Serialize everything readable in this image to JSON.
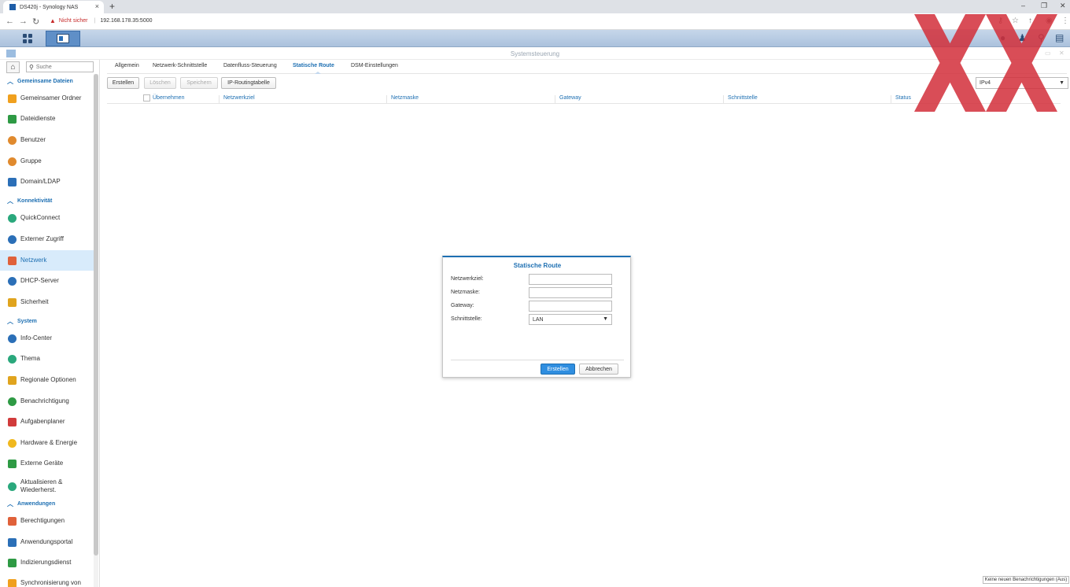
{
  "browser": {
    "tab_title": "DS420j - Synology NAS",
    "new_tab": "+",
    "not_secure": "Nicht sicher",
    "url": "192.168.178.35:5000"
  },
  "window": {
    "title": "Systemsteuerung"
  },
  "sidebar": {
    "search_placeholder": "Suche",
    "sections": [
      {
        "label": "Gemeinsame Dateien"
      },
      {
        "label": "Konnektivität"
      },
      {
        "label": "System"
      },
      {
        "label": "Anwendungen"
      }
    ],
    "items": [
      {
        "label": "Gemeinsamer Ordner",
        "color": "#f0a01e"
      },
      {
        "label": "Dateidienste",
        "color": "#2e9a44"
      },
      {
        "label": "Benutzer",
        "color": "#e08a2e"
      },
      {
        "label": "Gruppe",
        "color": "#e08a2e"
      },
      {
        "label": "Domain/LDAP",
        "color": "#2b6fb7"
      },
      {
        "label": "QuickConnect",
        "color": "#2aa87c"
      },
      {
        "label": "Externer Zugriff",
        "color": "#2b6fb7"
      },
      {
        "label": "Netzwerk",
        "color": "#e0613a"
      },
      {
        "label": "DHCP-Server",
        "color": "#2b6fb7"
      },
      {
        "label": "Sicherheit",
        "color": "#e0a41e"
      },
      {
        "label": "Info-Center",
        "color": "#2b6fb7"
      },
      {
        "label": "Thema",
        "color": "#2aa87c"
      },
      {
        "label": "Regionale Optionen",
        "color": "#e0a41e"
      },
      {
        "label": "Benachrichtigung",
        "color": "#2e9a44"
      },
      {
        "label": "Aufgabenplaner",
        "color": "#d13b3b"
      },
      {
        "label": "Hardware & Energie",
        "color": "#f0b81e"
      },
      {
        "label": "Externe Geräte",
        "color": "#2e9a44"
      },
      {
        "label": "Aktualisieren & Wiederherst.",
        "color": "#2aa87c"
      },
      {
        "label": "Berechtigungen",
        "color": "#e0613a"
      },
      {
        "label": "Anwendungsportal",
        "color": "#2b6fb7"
      },
      {
        "label": "Indizierungsdienst",
        "color": "#2e9a44"
      },
      {
        "label": "Synchronisierung von",
        "color": "#f0a01e"
      }
    ]
  },
  "tabs": [
    "Allgemein",
    "Netzwerk-Schnittstelle",
    "Datenfluss-Steuerung",
    "Statische Route",
    "DSM-Einstellungen"
  ],
  "toolbar": {
    "create": "Erstellen",
    "delete": "Löschen",
    "save": "Speichern",
    "routing_table": "IP-Routingtabelle",
    "ip_version": "IPv4"
  },
  "table": {
    "columns": [
      "Übernehmen",
      "Netzwerkziel",
      "Netzmaske",
      "Gateway",
      "Schnittstelle",
      "Status"
    ]
  },
  "dialog": {
    "title": "Statische Route",
    "fields": {
      "network_target": "Netzwerkziel:",
      "netmask": "Netzmaske:",
      "gateway": "Gateway:",
      "interface": "Schnittstelle:"
    },
    "interface_value": "LAN",
    "create": "Erstellen",
    "cancel": "Abbrechen"
  },
  "notification": "Keine neuen Benachrichtigungen (Aus)"
}
